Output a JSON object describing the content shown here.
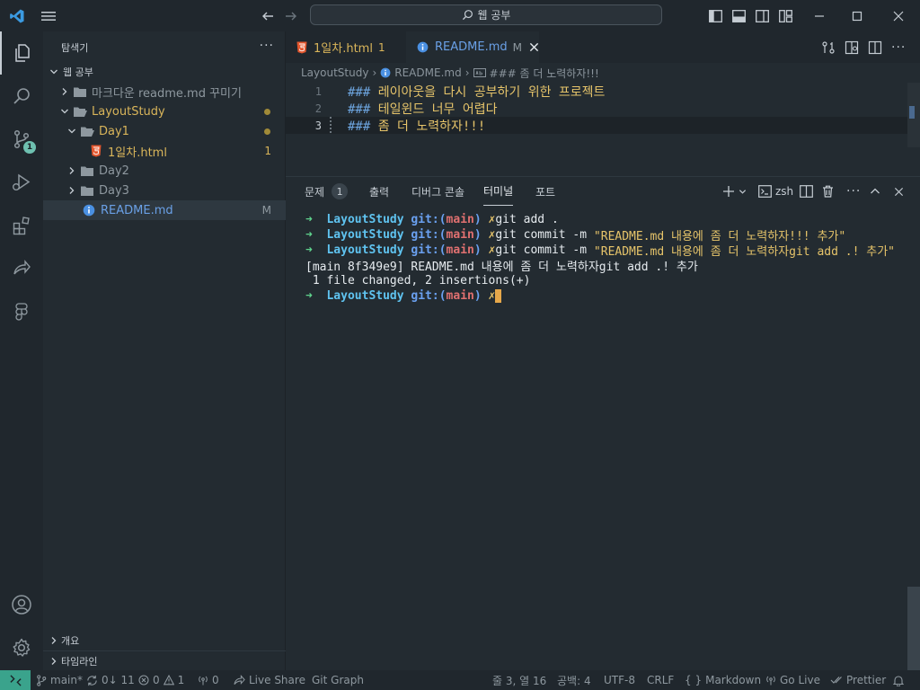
{
  "titlebar": {
    "search_text": "웹 공부"
  },
  "activitybar": {
    "source_control_badge": "1"
  },
  "sidebar": {
    "title": "탐색기",
    "more": "···",
    "root": "웹 공부",
    "items": [
      {
        "label": "마크다운 readme.md 꾸미기",
        "type": "folder",
        "expanded": false
      },
      {
        "label": "LayoutStudy",
        "type": "folder",
        "expanded": true
      },
      {
        "label": "Day1",
        "type": "folder",
        "expanded": true
      },
      {
        "label": "1일차.html",
        "type": "html-file",
        "deco": "1"
      },
      {
        "label": "Day2",
        "type": "folder",
        "expanded": false
      },
      {
        "label": "Day3",
        "type": "folder",
        "expanded": false
      },
      {
        "label": "README.md",
        "type": "info-file",
        "deco": "M"
      }
    ],
    "bottom": [
      {
        "label": "개요"
      },
      {
        "label": "타임라인"
      }
    ]
  },
  "tabs": [
    {
      "label": "1일차.html",
      "deco": "1",
      "active": false
    },
    {
      "label": "README.md",
      "deco": "M",
      "active": true
    }
  ],
  "breadcrumb": {
    "part1": "LayoutStudy",
    "part2": "README.md",
    "part3": "### 좀 더 노력하자!!!"
  },
  "editor": {
    "lines": [
      {
        "num": "1",
        "hash": "###",
        "text": " 레이아웃을 다시 공부하기 위한 프로젝트"
      },
      {
        "num": "2",
        "hash": "###",
        "text": " 테일윈드 너무 어렵다"
      },
      {
        "num": "3",
        "hash": "###",
        "text": " 좀 더 노력하자!!!"
      }
    ]
  },
  "panel": {
    "tabs": [
      {
        "label": "문제",
        "count": "1"
      },
      {
        "label": "출력"
      },
      {
        "label": "디버그 콘솔"
      },
      {
        "label": "터미널",
        "active": true
      },
      {
        "label": "포트"
      }
    ],
    "shell": "zsh",
    "prompt": {
      "arrow": "➜",
      "dir": "LayoutStudy",
      "git": "git:(",
      "branch": "main",
      "git_close": ")",
      "x": "✗"
    },
    "terminal": {
      "cmd1": "git add .",
      "cmd2_pre": "git commit -m ",
      "cmd2_str": "\"README.md 내용에 좀 더 노력하자!!! 추가\"",
      "cmd3_pre": "git commit -m ",
      "cmd3_str": "\"README.md 내용에 좀 더 노력하자git add .! 추가\"",
      "out1": "[main 8f349e9] README.md 내용에 좀 더 노력하자git add .! 추가",
      "out2": " 1 file changed, 2 insertions(+)"
    }
  },
  "statusbar": {
    "branch": "main*",
    "sync": "0↓ 11",
    "errors": "0",
    "warnings": "1",
    "ports": "0",
    "live_share": "Live Share",
    "git_graph": "Git Graph",
    "position": "줄 3, 열 16",
    "spaces": "공백: 4",
    "encoding": "UTF-8",
    "eol": "CRLF",
    "language": "Markdown",
    "go_live": "Go Live",
    "prettier": "Prettier"
  },
  "colors": {
    "accent_teal": "#3aa38c",
    "modified": "#a08a38",
    "heading_text": "#e6c46a"
  }
}
